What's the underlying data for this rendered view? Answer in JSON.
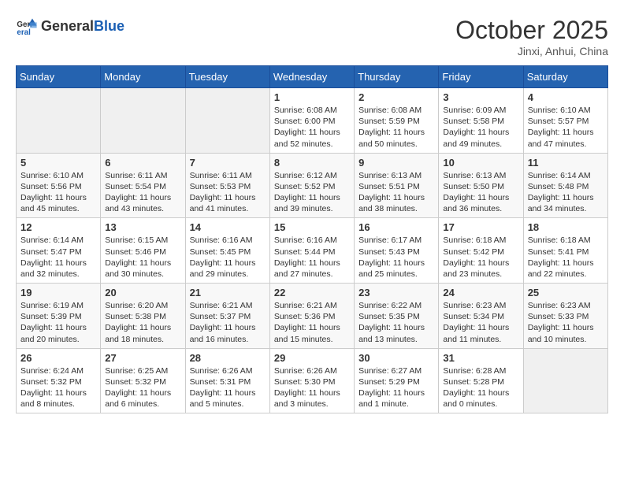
{
  "header": {
    "logo_general": "General",
    "logo_blue": "Blue",
    "month": "October 2025",
    "location": "Jinxi, Anhui, China"
  },
  "weekdays": [
    "Sunday",
    "Monday",
    "Tuesday",
    "Wednesday",
    "Thursday",
    "Friday",
    "Saturday"
  ],
  "weeks": [
    [
      {
        "day": "",
        "info": ""
      },
      {
        "day": "",
        "info": ""
      },
      {
        "day": "",
        "info": ""
      },
      {
        "day": "1",
        "info": "Sunrise: 6:08 AM\nSunset: 6:00 PM\nDaylight: 11 hours\nand 52 minutes."
      },
      {
        "day": "2",
        "info": "Sunrise: 6:08 AM\nSunset: 5:59 PM\nDaylight: 11 hours\nand 50 minutes."
      },
      {
        "day": "3",
        "info": "Sunrise: 6:09 AM\nSunset: 5:58 PM\nDaylight: 11 hours\nand 49 minutes."
      },
      {
        "day": "4",
        "info": "Sunrise: 6:10 AM\nSunset: 5:57 PM\nDaylight: 11 hours\nand 47 minutes."
      }
    ],
    [
      {
        "day": "5",
        "info": "Sunrise: 6:10 AM\nSunset: 5:56 PM\nDaylight: 11 hours\nand 45 minutes."
      },
      {
        "day": "6",
        "info": "Sunrise: 6:11 AM\nSunset: 5:54 PM\nDaylight: 11 hours\nand 43 minutes."
      },
      {
        "day": "7",
        "info": "Sunrise: 6:11 AM\nSunset: 5:53 PM\nDaylight: 11 hours\nand 41 minutes."
      },
      {
        "day": "8",
        "info": "Sunrise: 6:12 AM\nSunset: 5:52 PM\nDaylight: 11 hours\nand 39 minutes."
      },
      {
        "day": "9",
        "info": "Sunrise: 6:13 AM\nSunset: 5:51 PM\nDaylight: 11 hours\nand 38 minutes."
      },
      {
        "day": "10",
        "info": "Sunrise: 6:13 AM\nSunset: 5:50 PM\nDaylight: 11 hours\nand 36 minutes."
      },
      {
        "day": "11",
        "info": "Sunrise: 6:14 AM\nSunset: 5:48 PM\nDaylight: 11 hours\nand 34 minutes."
      }
    ],
    [
      {
        "day": "12",
        "info": "Sunrise: 6:14 AM\nSunset: 5:47 PM\nDaylight: 11 hours\nand 32 minutes."
      },
      {
        "day": "13",
        "info": "Sunrise: 6:15 AM\nSunset: 5:46 PM\nDaylight: 11 hours\nand 30 minutes."
      },
      {
        "day": "14",
        "info": "Sunrise: 6:16 AM\nSunset: 5:45 PM\nDaylight: 11 hours\nand 29 minutes."
      },
      {
        "day": "15",
        "info": "Sunrise: 6:16 AM\nSunset: 5:44 PM\nDaylight: 11 hours\nand 27 minutes."
      },
      {
        "day": "16",
        "info": "Sunrise: 6:17 AM\nSunset: 5:43 PM\nDaylight: 11 hours\nand 25 minutes."
      },
      {
        "day": "17",
        "info": "Sunrise: 6:18 AM\nSunset: 5:42 PM\nDaylight: 11 hours\nand 23 minutes."
      },
      {
        "day": "18",
        "info": "Sunrise: 6:18 AM\nSunset: 5:41 PM\nDaylight: 11 hours\nand 22 minutes."
      }
    ],
    [
      {
        "day": "19",
        "info": "Sunrise: 6:19 AM\nSunset: 5:39 PM\nDaylight: 11 hours\nand 20 minutes."
      },
      {
        "day": "20",
        "info": "Sunrise: 6:20 AM\nSunset: 5:38 PM\nDaylight: 11 hours\nand 18 minutes."
      },
      {
        "day": "21",
        "info": "Sunrise: 6:21 AM\nSunset: 5:37 PM\nDaylight: 11 hours\nand 16 minutes."
      },
      {
        "day": "22",
        "info": "Sunrise: 6:21 AM\nSunset: 5:36 PM\nDaylight: 11 hours\nand 15 minutes."
      },
      {
        "day": "23",
        "info": "Sunrise: 6:22 AM\nSunset: 5:35 PM\nDaylight: 11 hours\nand 13 minutes."
      },
      {
        "day": "24",
        "info": "Sunrise: 6:23 AM\nSunset: 5:34 PM\nDaylight: 11 hours\nand 11 minutes."
      },
      {
        "day": "25",
        "info": "Sunrise: 6:23 AM\nSunset: 5:33 PM\nDaylight: 11 hours\nand 10 minutes."
      }
    ],
    [
      {
        "day": "26",
        "info": "Sunrise: 6:24 AM\nSunset: 5:32 PM\nDaylight: 11 hours\nand 8 minutes."
      },
      {
        "day": "27",
        "info": "Sunrise: 6:25 AM\nSunset: 5:32 PM\nDaylight: 11 hours\nand 6 minutes."
      },
      {
        "day": "28",
        "info": "Sunrise: 6:26 AM\nSunset: 5:31 PM\nDaylight: 11 hours\nand 5 minutes."
      },
      {
        "day": "29",
        "info": "Sunrise: 6:26 AM\nSunset: 5:30 PM\nDaylight: 11 hours\nand 3 minutes."
      },
      {
        "day": "30",
        "info": "Sunrise: 6:27 AM\nSunset: 5:29 PM\nDaylight: 11 hours\nand 1 minute."
      },
      {
        "day": "31",
        "info": "Sunrise: 6:28 AM\nSunset: 5:28 PM\nDaylight: 11 hours\nand 0 minutes."
      },
      {
        "day": "",
        "info": ""
      }
    ]
  ]
}
